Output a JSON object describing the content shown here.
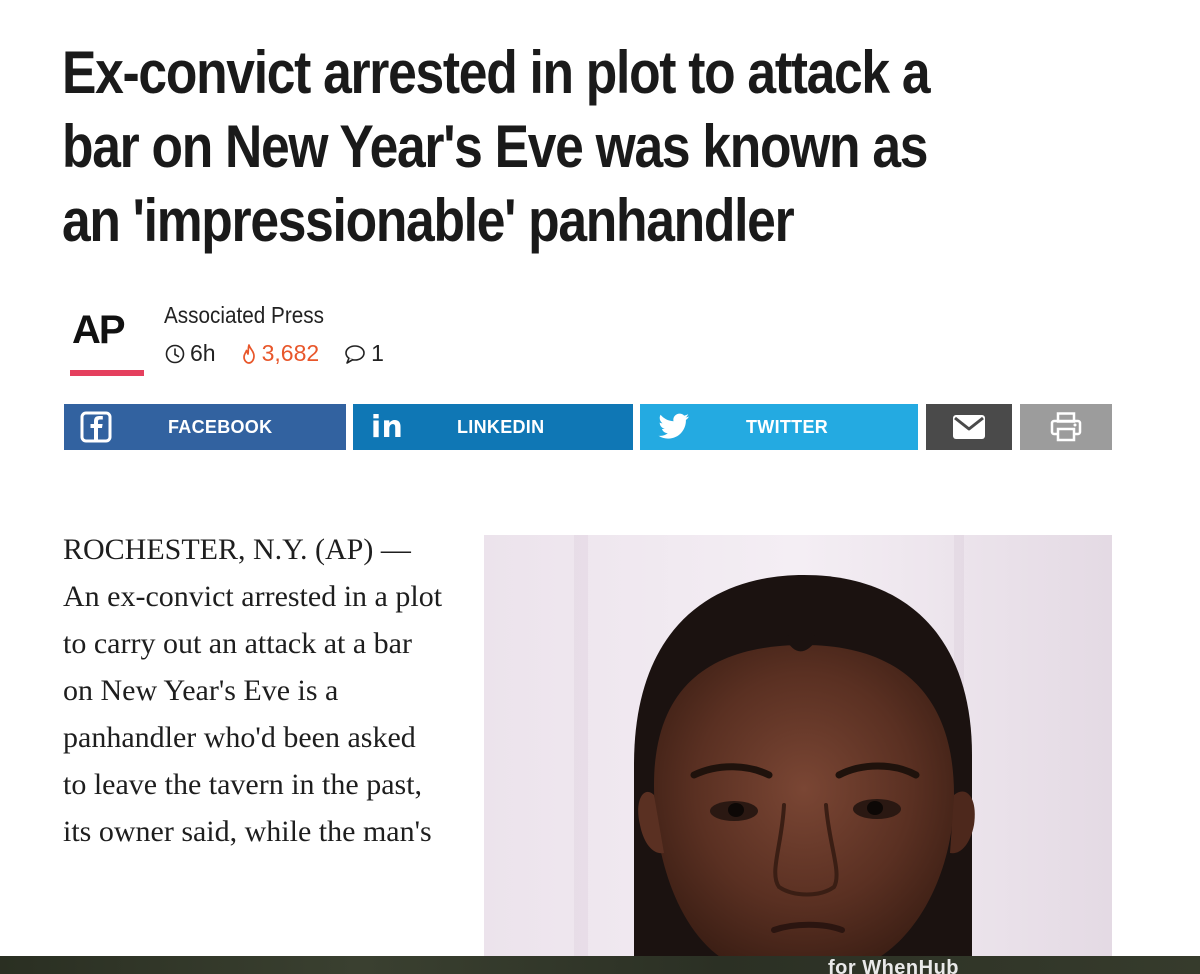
{
  "article": {
    "headline": "Ex-convict arrested in plot to attack a bar on New Year's Eve was known as an 'impressionable' panhandler",
    "body_text": "ROCHESTER, N.Y. (AP) — An ex-convict arrested in a plot to carry out an attack at a bar on New Year's Eve is a panhandler who'd been asked to leave the tavern in the past, its owner said, while the man's"
  },
  "byline": {
    "logo_text": "AP",
    "source_name": "Associated Press",
    "time_ago": "6h",
    "views": "3,682",
    "comments": "1",
    "logo_bar_color": "#e5405e",
    "views_color": "#e8562a"
  },
  "share": {
    "facebook_label": "FACEBOOK",
    "linkedin_label": "LINKEDIN",
    "linkedin_icon_text": "in",
    "twitter_label": "TWITTER",
    "facebook_color": "#3262a0",
    "linkedin_color": "#0f77b5",
    "twitter_color": "#24aae1",
    "email_color": "#4a4a4a",
    "print_color": "#9c9c9c",
    "icons": [
      "facebook-icon",
      "linkedin-icon",
      "twitter-icon",
      "email-icon",
      "print-icon"
    ]
  },
  "ad": {
    "text": "for WhenHub"
  }
}
